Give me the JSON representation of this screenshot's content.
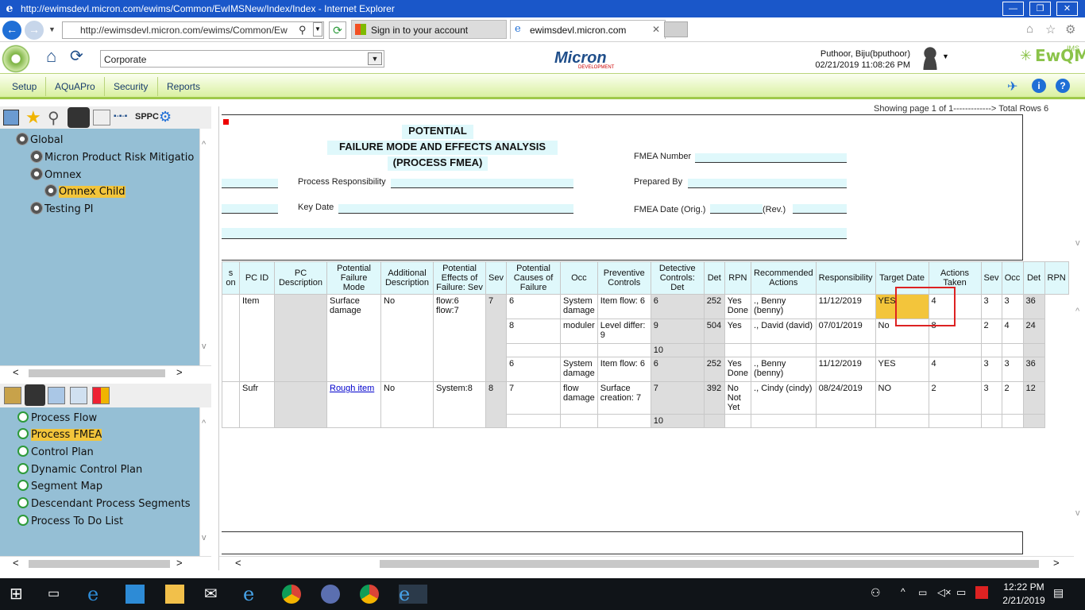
{
  "window": {
    "title": "http://ewimsdevl.micron.com/ewims/Common/EwIMSNew/Index/Index - Internet Explorer"
  },
  "browser": {
    "address": "http://ewimsdevl.micron.com/ewims/Common/Ew",
    "tabs": [
      {
        "label": "Sign in to your account"
      },
      {
        "label": "ewimsdevl.micron.com"
      }
    ]
  },
  "app": {
    "plant": "Corporate",
    "logo": "Micron",
    "logo_sub": "DEVELOPMENT",
    "user": "Puthoor, Biju(bputhoor)",
    "datetime": "02/21/2019 11:08:26 PM",
    "brand": "EwQMS",
    "brand_sup": "IMS"
  },
  "menu": [
    "Setup",
    "AQuAPro",
    "Security",
    "Reports"
  ],
  "toolbar": {
    "sppc": "SPPC"
  },
  "tree": [
    {
      "label": "Global",
      "level": 0
    },
    {
      "label": "Micron Product Risk Mitigatio",
      "level": 1
    },
    {
      "label": "Omnex",
      "level": 1
    },
    {
      "label": "Omnex Child",
      "level": 2,
      "selected": true
    },
    {
      "label": "Testing PI",
      "level": 1
    }
  ],
  "nav": [
    {
      "label": "Process Flow"
    },
    {
      "label": "Process FMEA",
      "selected": true
    },
    {
      "label": "Control Plan"
    },
    {
      "label": "Dynamic Control Plan"
    },
    {
      "label": "Segment Map"
    },
    {
      "label": "Descendant Process Segments"
    },
    {
      "label": "Process To Do List"
    }
  ],
  "paging": "Showing page 1 of 1-------------> Total Rows 6",
  "form": {
    "title1": "POTENTIAL",
    "title2": "FAILURE MODE AND EFFECTS ANALYSIS",
    "title3": "(PROCESS FMEA)",
    "fmea_number": "FMEA Number",
    "process_resp": "Process Responsibility",
    "prepared_by": "Prepared By",
    "key_date": "Key Date",
    "fmea_date": "FMEA Date (Orig.)",
    "rev": "(Rev.)"
  },
  "grid": {
    "headers": [
      "s\non",
      "PC ID",
      "PC Description",
      "Potential Failure Mode",
      "Additional Description",
      "Potential Effects of Failure: Sev",
      "Sev",
      "Potential Causes of Failure",
      "Occ",
      "Preventive Controls",
      "Detective Controls: Det",
      "Det",
      "RPN",
      "Recommended Actions",
      "Responsibility",
      "Target Date",
      "Actions Taken",
      "Sev",
      "Occ",
      "Det",
      "RPN"
    ],
    "groups": [
      {
        "pcid": "Item",
        "mode": "Surface damage",
        "addl": "No",
        "effects": "flow:6\nflow:7",
        "sev": "7",
        "rows": [
          {
            "occ": "6",
            "prev": "System damage",
            "det_ctrl": "Item flow: 6",
            "det": "6",
            "rpn": "252",
            "rec": "Yes Done",
            "resp": "., Benny (benny)",
            "target": "11/12/2019",
            "taken": "YES",
            "sev2": "4",
            "occ2": "3",
            "det2": "3",
            "rpn2": "36"
          },
          {
            "occ": "8",
            "prev": "moduler",
            "det_ctrl": "Level differ: 9",
            "det": "9",
            "rpn": "504",
            "rec": "Yes",
            "resp": "., David (david)",
            "target": "07/01/2019",
            "taken": "No",
            "sev2": "8",
            "occ2": "2",
            "det2": "4",
            "rpn2": "24"
          },
          {
            "occ": "",
            "prev": "",
            "det_ctrl": "",
            "det": "10",
            "rpn": "",
            "rec": "",
            "resp": "",
            "target": "",
            "taken": "",
            "sev2": "",
            "occ2": "",
            "det2": "",
            "rpn2": ""
          },
          {
            "occ": "6",
            "prev": "System damage",
            "det_ctrl": "Item flow: 6",
            "det": "6",
            "rpn": "252",
            "rec": "Yes Done",
            "resp": "., Benny (benny)",
            "target": "11/12/2019",
            "taken": "YES",
            "sev2": "4",
            "occ2": "3",
            "det2": "3",
            "rpn2": "36"
          }
        ]
      },
      {
        "pcid": "Sufr",
        "mode": "Rough item",
        "addl": "No",
        "effects": "System:8",
        "sev": "8",
        "rows": [
          {
            "occ": "7",
            "prev": "flow damage",
            "det_ctrl": "Surface creation: 7",
            "det": "7",
            "rpn": "392",
            "rec": "No Not Yet",
            "resp": "., Cindy (cindy)",
            "target": "08/24/2019",
            "taken": "NO",
            "sev2": "2",
            "occ2": "3",
            "det2": "2",
            "rpn2": "12"
          },
          {
            "occ": "",
            "prev": "",
            "det_ctrl": "",
            "det": "10",
            "rpn": "",
            "rec": "",
            "resp": "",
            "target": "",
            "taken": "",
            "sev2": "",
            "occ2": "",
            "det2": "",
            "rpn2": ""
          }
        ]
      }
    ]
  },
  "clock": {
    "time": "12:22 PM",
    "date": "2/21/2019"
  },
  "colors": {
    "menu_accent": "#9fc94a",
    "panel": "#95bfd5",
    "selected": "#f3c53b",
    "header_cell": "#dff8fb",
    "titlebar": "#1a57c9"
  }
}
